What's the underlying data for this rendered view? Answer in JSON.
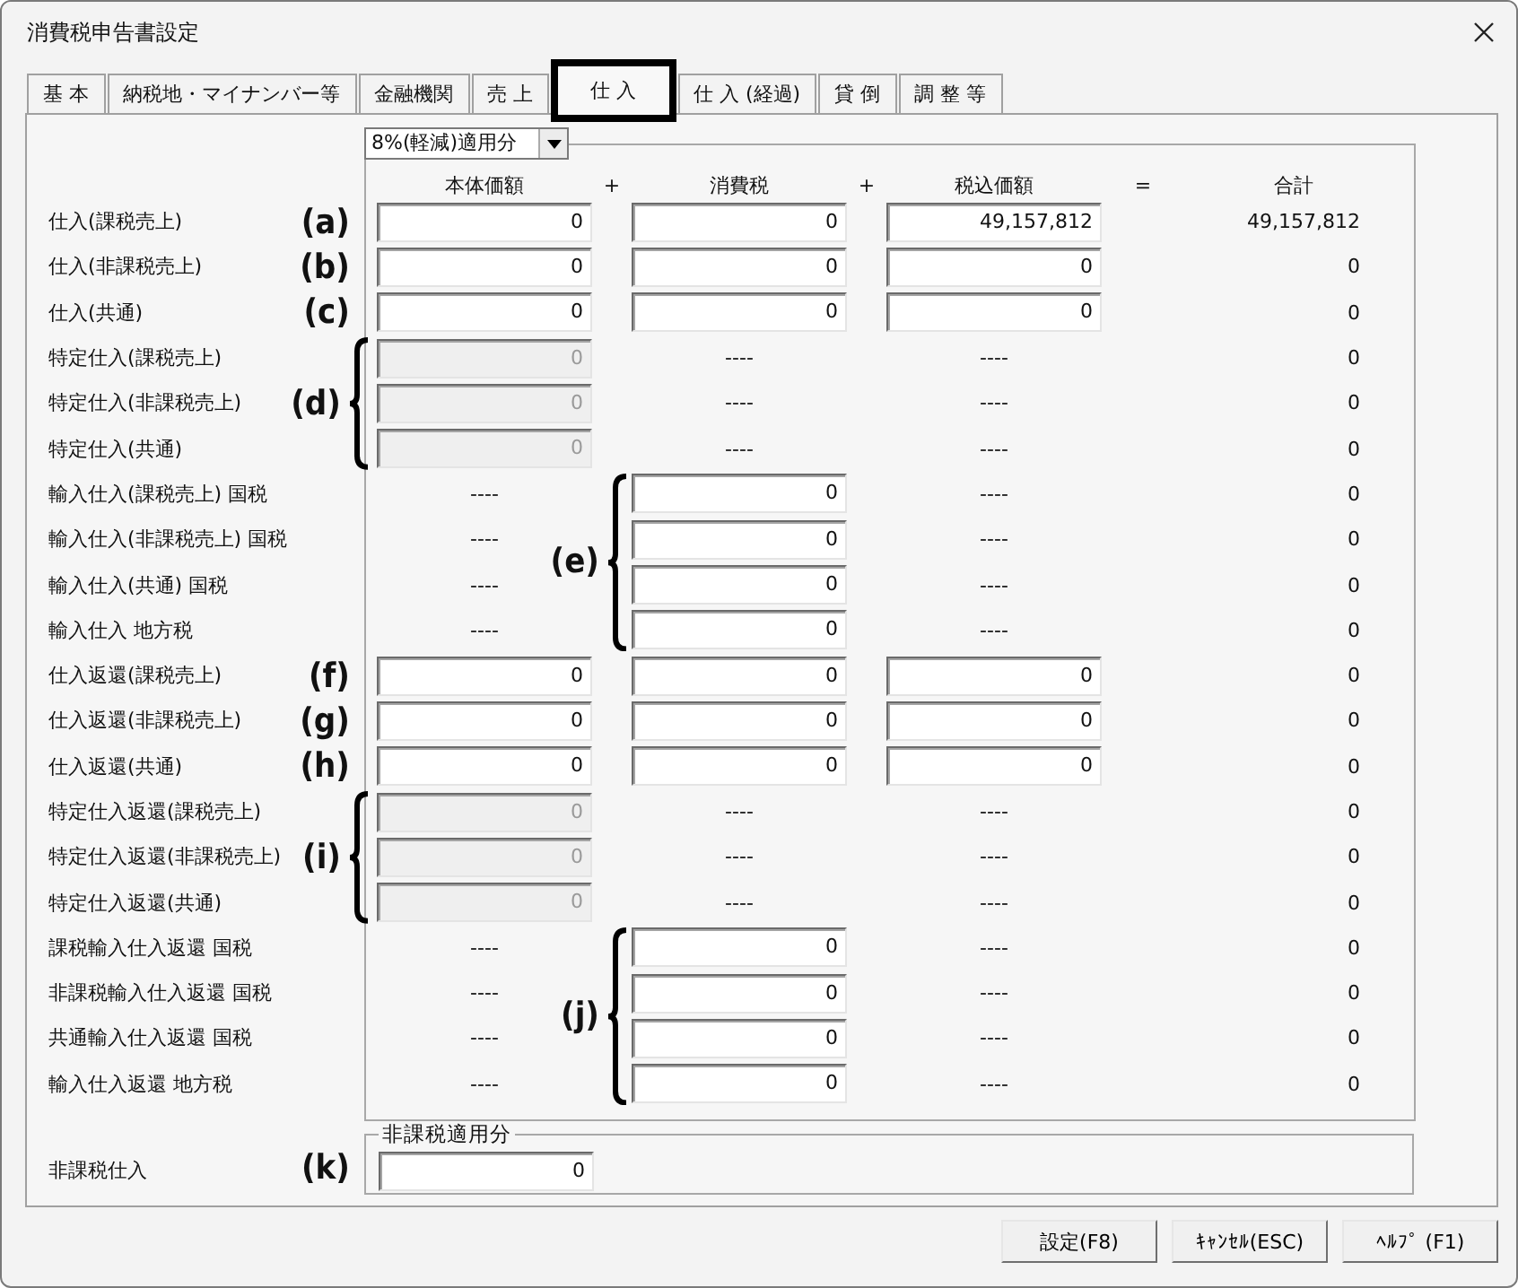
{
  "window": {
    "title": "消費税申告書設定"
  },
  "tabs": [
    {
      "label": "基 本",
      "selected": false
    },
    {
      "label": "納税地・マイナンバー等",
      "selected": false
    },
    {
      "label": "金融機関",
      "selected": false
    },
    {
      "label": "売 上",
      "selected": false
    },
    {
      "label": "仕 入",
      "selected": true
    },
    {
      "label": "仕 入 (経過)",
      "selected": false
    },
    {
      "label": "貸 倒",
      "selected": false
    },
    {
      "label": "調 整 等",
      "selected": false
    }
  ],
  "rate_dropdown": {
    "value": "8%(軽減)適用分"
  },
  "columns": [
    "本体価額",
    "消費税",
    "税込価額",
    "合計"
  ],
  "operators": [
    "+",
    "+",
    "="
  ],
  "sections": [
    {
      "marker": "(a)",
      "brace": false,
      "rows": [
        {
          "label": "仕入(課税売上)",
          "cells": [
            {
              "kind": "input",
              "value": "0"
            },
            {
              "kind": "input",
              "value": "0"
            },
            {
              "kind": "input",
              "value": "49,157,812"
            }
          ],
          "total": "49,157,812"
        }
      ]
    },
    {
      "marker": "(b)",
      "brace": false,
      "rows": [
        {
          "label": "仕入(非課税売上)",
          "cells": [
            {
              "kind": "input",
              "value": "0"
            },
            {
              "kind": "input",
              "value": "0"
            },
            {
              "kind": "input",
              "value": "0"
            }
          ],
          "total": "0"
        }
      ]
    },
    {
      "marker": "(c)",
      "brace": false,
      "rows": [
        {
          "label": "仕入(共通)",
          "cells": [
            {
              "kind": "input",
              "value": "0"
            },
            {
              "kind": "input",
              "value": "0"
            },
            {
              "kind": "input",
              "value": "0"
            }
          ],
          "total": "0"
        }
      ]
    },
    {
      "marker": "(d)",
      "brace": true,
      "rows": [
        {
          "label": "特定仕入(課税売上)",
          "cells": [
            {
              "kind": "disabled",
              "value": "0"
            },
            {
              "kind": "dash",
              "value": "----"
            },
            {
              "kind": "dash",
              "value": "----"
            }
          ],
          "total": "0"
        },
        {
          "label": "特定仕入(非課税売上)",
          "cells": [
            {
              "kind": "disabled",
              "value": "0"
            },
            {
              "kind": "dash",
              "value": "----"
            },
            {
              "kind": "dash",
              "value": "----"
            }
          ],
          "total": "0"
        },
        {
          "label": "特定仕入(共通)",
          "cells": [
            {
              "kind": "disabled",
              "value": "0"
            },
            {
              "kind": "dash",
              "value": "----"
            },
            {
              "kind": "dash",
              "value": "----"
            }
          ],
          "total": "0"
        }
      ]
    },
    {
      "marker": "(e)",
      "brace": true,
      "rows": [
        {
          "label": "輸入仕入(課税売上) 国税",
          "cells": [
            {
              "kind": "dash",
              "value": "----"
            },
            {
              "kind": "input",
              "value": "0"
            },
            {
              "kind": "dash",
              "value": "----"
            }
          ],
          "total": "0"
        },
        {
          "label": "輸入仕入(非課税売上) 国税",
          "cells": [
            {
              "kind": "dash",
              "value": "----"
            },
            {
              "kind": "input",
              "value": "0"
            },
            {
              "kind": "dash",
              "value": "----"
            }
          ],
          "total": "0"
        },
        {
          "label": "輸入仕入(共通) 国税",
          "cells": [
            {
              "kind": "dash",
              "value": "----"
            },
            {
              "kind": "input",
              "value": "0"
            },
            {
              "kind": "dash",
              "value": "----"
            }
          ],
          "total": "0"
        },
        {
          "label": "輸入仕入 地方税",
          "cells": [
            {
              "kind": "dash",
              "value": "----"
            },
            {
              "kind": "input",
              "value": "0"
            },
            {
              "kind": "dash",
              "value": "----"
            }
          ],
          "total": "0"
        }
      ]
    },
    {
      "marker": "(f)",
      "brace": false,
      "rows": [
        {
          "label": "仕入返還(課税売上)",
          "cells": [
            {
              "kind": "input",
              "value": "0"
            },
            {
              "kind": "input",
              "value": "0"
            },
            {
              "kind": "input",
              "value": "0"
            }
          ],
          "total": "0"
        }
      ]
    },
    {
      "marker": "(g)",
      "brace": false,
      "rows": [
        {
          "label": "仕入返還(非課税売上)",
          "cells": [
            {
              "kind": "input",
              "value": "0"
            },
            {
              "kind": "input",
              "value": "0"
            },
            {
              "kind": "input",
              "value": "0"
            }
          ],
          "total": "0"
        }
      ]
    },
    {
      "marker": "(h)",
      "brace": false,
      "rows": [
        {
          "label": "仕入返還(共通)",
          "cells": [
            {
              "kind": "input",
              "value": "0"
            },
            {
              "kind": "input",
              "value": "0"
            },
            {
              "kind": "input",
              "value": "0"
            }
          ],
          "total": "0"
        }
      ]
    },
    {
      "marker": "(i)",
      "brace": true,
      "rows": [
        {
          "label": "特定仕入返還(課税売上)",
          "cells": [
            {
              "kind": "disabled",
              "value": "0"
            },
            {
              "kind": "dash",
              "value": "----"
            },
            {
              "kind": "dash",
              "value": "----"
            }
          ],
          "total": "0"
        },
        {
          "label": "特定仕入返還(非課税売上)",
          "cells": [
            {
              "kind": "disabled",
              "value": "0"
            },
            {
              "kind": "dash",
              "value": "----"
            },
            {
              "kind": "dash",
              "value": "----"
            }
          ],
          "total": "0"
        },
        {
          "label": "特定仕入返還(共通)",
          "cells": [
            {
              "kind": "disabled",
              "value": "0"
            },
            {
              "kind": "dash",
              "value": "----"
            },
            {
              "kind": "dash",
              "value": "----"
            }
          ],
          "total": "0"
        }
      ]
    },
    {
      "marker": "(j)",
      "brace": true,
      "rows": [
        {
          "label": "課税輸入仕入返還 国税",
          "cells": [
            {
              "kind": "dash",
              "value": "----"
            },
            {
              "kind": "input",
              "value": "0"
            },
            {
              "kind": "dash",
              "value": "----"
            }
          ],
          "total": "0"
        },
        {
          "label": "非課税輸入仕入返還 国税",
          "cells": [
            {
              "kind": "dash",
              "value": "----"
            },
            {
              "kind": "input",
              "value": "0"
            },
            {
              "kind": "dash",
              "value": "----"
            }
          ],
          "total": "0"
        },
        {
          "label": "共通輸入仕入返還 国税",
          "cells": [
            {
              "kind": "dash",
              "value": "----"
            },
            {
              "kind": "input",
              "value": "0"
            },
            {
              "kind": "dash",
              "value": "----"
            }
          ],
          "total": "0"
        },
        {
          "label": "輸入仕入返還 地方税",
          "cells": [
            {
              "kind": "dash",
              "value": "----"
            },
            {
              "kind": "input",
              "value": "0"
            },
            {
              "kind": "dash",
              "value": "----"
            }
          ],
          "total": "0"
        }
      ]
    }
  ],
  "exempt_group": {
    "title": "非課税適用分",
    "label": "非課税仕入",
    "marker": "(k)",
    "value": "0"
  },
  "buttons": [
    "設定(F8)",
    "ｷｬﾝｾﾙ(ESC)",
    "ﾍﾙﾌﾟ (F1)"
  ]
}
